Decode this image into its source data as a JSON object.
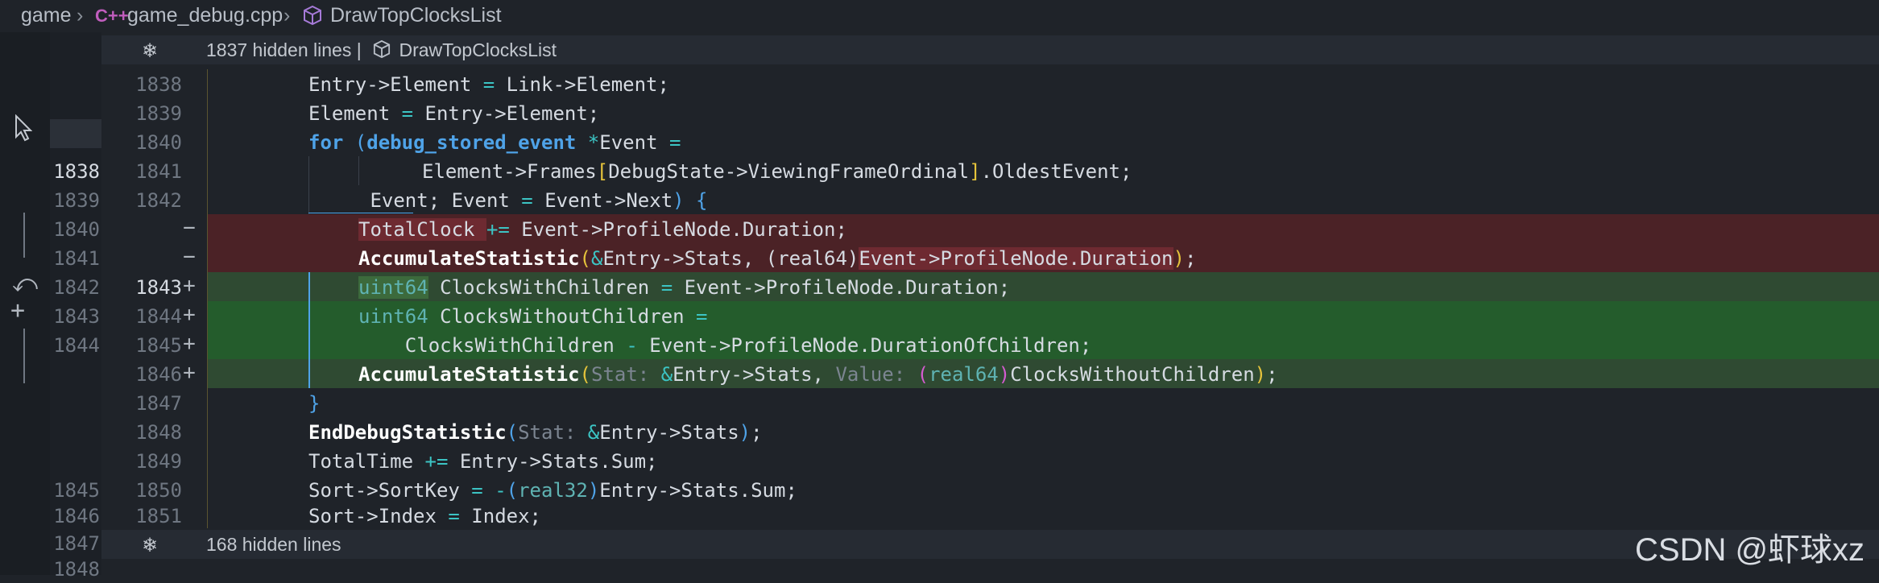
{
  "breadcrumb": {
    "items": [
      "game",
      "game_debug.cpp",
      "DrawTopClocksList"
    ],
    "file_icon": "C++"
  },
  "fold_top": {
    "text": "1837 hidden lines  |",
    "symbol": "DrawTopClocksList"
  },
  "fold_bottom": {
    "text": "168 hidden lines"
  },
  "left_numbers": [
    "1838",
    "1839",
    "1840",
    "1841",
    "1842",
    "1843",
    "1844",
    "1845",
    "1846",
    "1847",
    "1848"
  ],
  "old_numbers": [
    "1838",
    "1839",
    "1840",
    "1841",
    "1842",
    "1843",
    "1844",
    "1845",
    "1846",
    "1847",
    "1848",
    "1849",
    "1850",
    "1851"
  ],
  "new_numbers": [
    "1843",
    "1844",
    "1845",
    "1846"
  ],
  "markers": {
    "minus": "−",
    "plus": "+"
  },
  "lines": {
    "l1838": {
      "p1": "Entry->Element ",
      "p2": "=",
      "p3": " Link->Element;"
    },
    "l1839": {
      "p1": "Element ",
      "p2": "=",
      "p3": " Entry->Element;"
    },
    "l1840": {
      "kw": "for",
      "br": " (",
      "ty": "debug_stored_event",
      "op": " *",
      "rest": "Event ",
      "eq": "="
    },
    "l1841": {
      "a": "Element->Frames",
      "b": "[",
      "c": "DebugState->ViewingFrameOrdinal",
      "d": "]",
      "e": ".OldestEvent;"
    },
    "l1842": {
      "a": " Event; Event ",
      "b": "=",
      "c": " Event->Next",
      "d": ")",
      "e": " {"
    },
    "del1": {
      "a": "TotalClock ",
      "b": "+=",
      "c": " Event->ProfileNode.Duration;"
    },
    "del2": {
      "fn": "AccumulateStatistic",
      "o": "(",
      "amp": "&",
      "a": "Entry->Stats, ",
      "p": "(",
      "t": "real64",
      "pc": ")",
      "b": "Event->ProfileNode.Duration",
      "c": ")",
      ";": ";"
    },
    "add1": {
      "t": "uint64",
      "a": " ClocksWithChildren ",
      "b": "=",
      "c": " Event->ProfileNode.Duration;"
    },
    "add2": {
      "t": "uint64",
      "a": " ClocksWithoutChildren ",
      "b": "="
    },
    "add3": {
      "a": "    ClocksWithChildren ",
      "b": "-",
      "c": " Event->ProfileNode.DurationOfChildren;"
    },
    "add4": {
      "fn": "AccumulateStatistic",
      "o": "(",
      "h1": "Stat:",
      "amp": "&",
      "a": "Entry->Stats, ",
      "h2": "Value:",
      "p": "(",
      "t": "real64",
      "pc": ")",
      "b": "ClocksWithoutChildren",
      "c": ")",
      ";": ";"
    },
    "l1847": {
      "a": "}"
    },
    "l1848": {
      "fn": "EndDebugStatistic",
      "o": "(",
      "h1": "Stat:",
      "amp": "&",
      "a": "Entry->Stats",
      "c": ")",
      ";": ";"
    },
    "l1849": {
      "a": "TotalTime ",
      "b": "+=",
      "c": " Entry->Stats.Sum;"
    },
    "l1850": {
      "a": "Sort->SortKey ",
      "b": "=",
      "c": " -",
      "p": "(",
      "t": "real32",
      "pc": ")",
      "d": "Entry->Stats.Sum;"
    },
    "l1851": {
      "a": "Sort->Index ",
      "b": "=",
      "c": " Index;"
    }
  },
  "watermark": "CSDN @虾球xz",
  "colors": {
    "deleted_bg": "#4b2226",
    "deleted_word_bg": "#6e2a31",
    "added_bg": "#2f4a32",
    "added_strong_bg": "#245c2c"
  }
}
